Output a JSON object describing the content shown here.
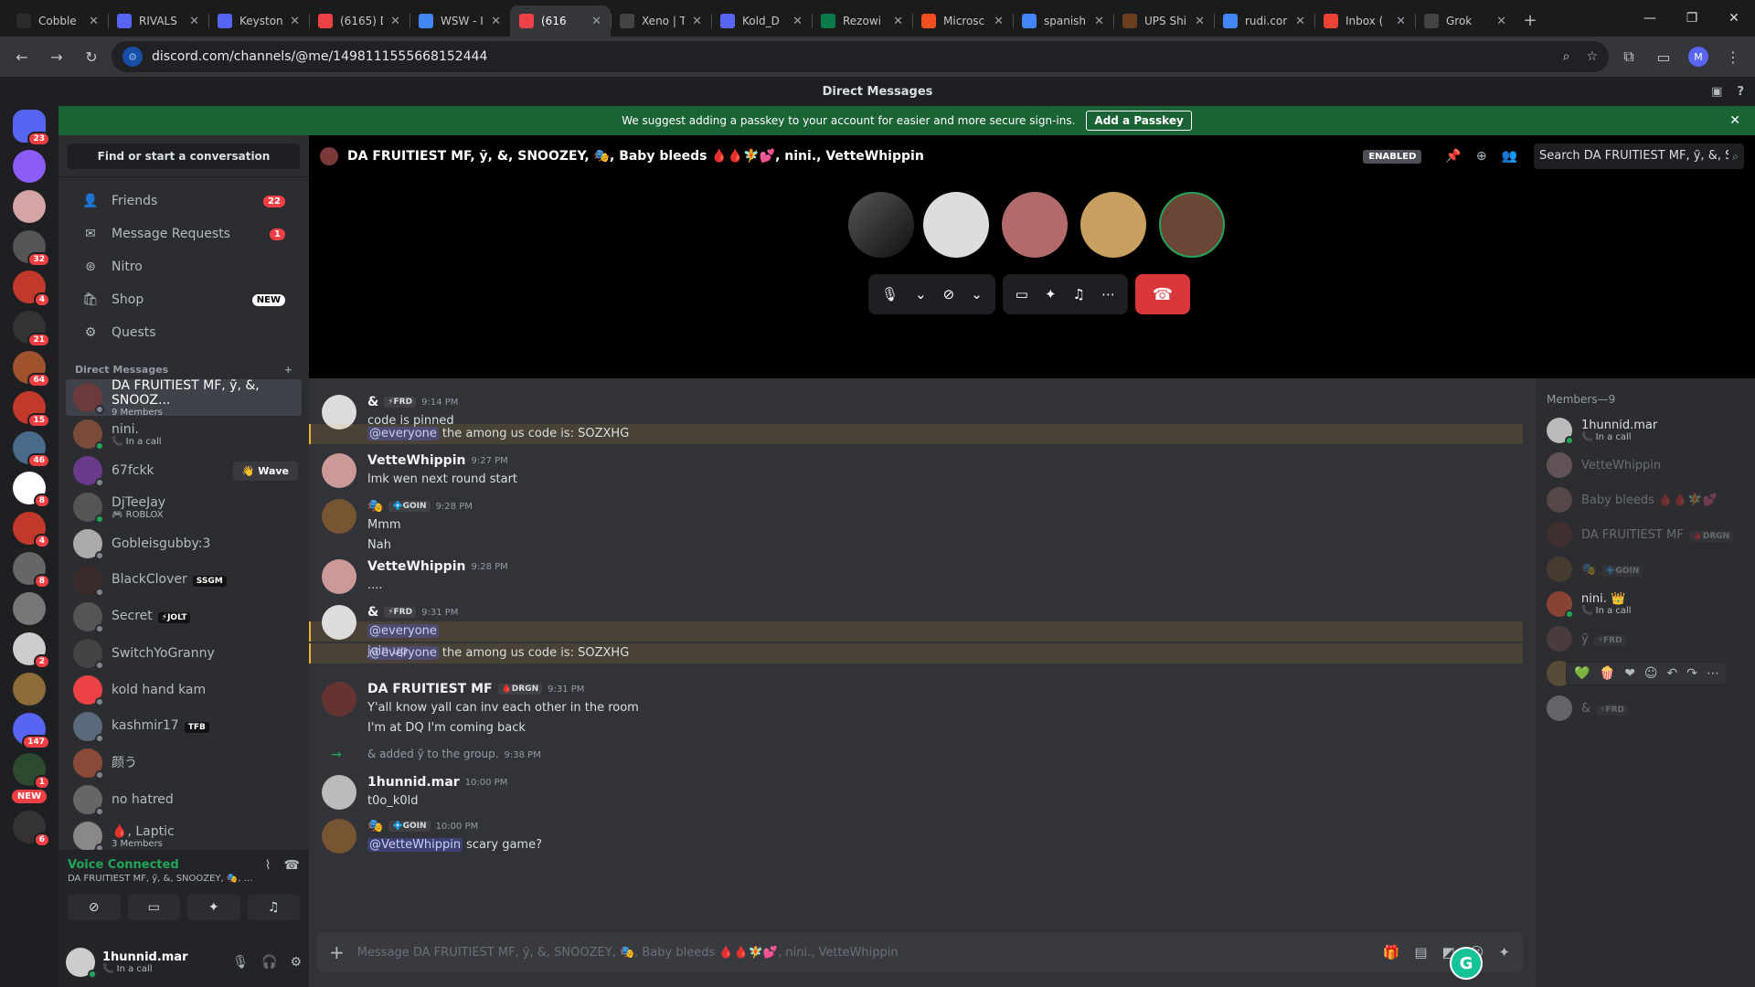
{
  "browser": {
    "tabs": [
      {
        "title": "Cobble",
        "color": "#2b2b2b"
      },
      {
        "title": "RIVALS",
        "color": "#5865f2"
      },
      {
        "title": "Keyston",
        "color": "#5865f2"
      },
      {
        "title": "(6165) D",
        "color": "#ed4245"
      },
      {
        "title": "WSW - I",
        "color": "#4285f4"
      },
      {
        "title": "(616",
        "color": "#ed4245"
      },
      {
        "title": "Xeno | T",
        "color": "#444"
      },
      {
        "title": "Kold_D",
        "color": "#5865f2"
      },
      {
        "title": "Rezowi",
        "color": "#0b7a4b"
      },
      {
        "title": "Microsc",
        "color": "#f25022"
      },
      {
        "title": "spanish",
        "color": "#4285f4"
      },
      {
        "title": "UPS Shi",
        "color": "#6b3e1f"
      },
      {
        "title": "rudi.cor",
        "color": "#4285f4"
      },
      {
        "title": "Inbox (",
        "color": "#ea4335"
      },
      {
        "title": "Grok",
        "color": "#444"
      }
    ],
    "url": "discord.com/channels/@me/1498111555668152444",
    "profile_initial": "M"
  },
  "app": {
    "window_title": "Direct Messages",
    "banner_text": "We suggest adding a passkey to your account for easier and more secure sign-ins.",
    "banner_button": "Add a Passkey"
  },
  "guilds": [
    {
      "badge": "23",
      "color": "#5865f2"
    },
    {
      "badge": "",
      "color": "#8b5cf6"
    },
    {
      "badge": "",
      "color": "#d4a5a5"
    },
    {
      "badge": "32",
      "color": "#555"
    },
    {
      "badge": "4",
      "color": "#c0392b"
    },
    {
      "badge": "21",
      "color": "#333"
    },
    {
      "badge": "64",
      "color": "#a0522d"
    },
    {
      "badge": "15",
      "color": "#c0392b"
    },
    {
      "badge": "46",
      "color": "#4a6a8a"
    },
    {
      "badge": "8",
      "color": "#fff"
    },
    {
      "badge": "4",
      "color": "#c0392b"
    },
    {
      "badge": "8",
      "color": "#666"
    },
    {
      "badge": "",
      "color": "#777"
    },
    {
      "badge": "2",
      "color": "#ccc"
    },
    {
      "badge": "",
      "color": "#8e6c3a"
    },
    {
      "badge": "147",
      "color": "#5865f2"
    },
    {
      "badge": "1",
      "color": "#2e4a2e"
    },
    {
      "badge": "6",
      "color": "#333"
    }
  ],
  "guild_new_label": "NEW",
  "dm_sidebar": {
    "search_label": "Find or start a conversation",
    "nav": [
      {
        "label": "Friends",
        "count": "22",
        "icon": "👤"
      },
      {
        "label": "Message Requests",
        "count": "1",
        "icon": "✉"
      },
      {
        "label": "Nitro",
        "count": "",
        "icon": "⊛"
      },
      {
        "label": "Shop",
        "count": "",
        "new": "NEW",
        "icon": "🛍"
      },
      {
        "label": "Quests",
        "count": "",
        "icon": "⚙"
      }
    ],
    "dm_header": "Direct Messages",
    "dm_add": "+",
    "dms": [
      {
        "name": "DA FRUITIEST MF, ỹ, &, SNOOZ...",
        "status": "9 Members",
        "color": "#6b3a3a",
        "online": false
      },
      {
        "name": "nini.",
        "status": "📞 In a call",
        "color": "#7a4a3a",
        "online": true
      },
      {
        "name": "67fckk",
        "status": "",
        "color": "#6a3a8a",
        "online": false
      },
      {
        "name": "DjTeeJay",
        "status": "🎮 ROBLOX",
        "color": "#555",
        "online": true
      },
      {
        "name": "Gobleisgubby:3",
        "status": "",
        "color": "#aaa",
        "online": false
      },
      {
        "name": "BlackClover",
        "status": "",
        "tag": "SSGM",
        "color": "#3a2a2a",
        "online": false
      },
      {
        "name": "Secret",
        "status": "",
        "tag": "⚡JOLT",
        "color": "#555",
        "online": false
      },
      {
        "name": "SwitchYoGranny",
        "status": "",
        "color": "#444",
        "online": false
      },
      {
        "name": "kold hand kam",
        "status": "",
        "color": "#ed4245",
        "online": false
      },
      {
        "name": "kashmir17",
        "status": "",
        "tag": "TFB",
        "color": "#5a6a7a",
        "online": false
      },
      {
        "name": "颜う",
        "status": "",
        "color": "#8a4a3a",
        "online": false
      },
      {
        "name": "no hatred",
        "status": "",
        "color": "#666",
        "online": false
      },
      {
        "name": "🩸, Laptic",
        "status": "3 Members",
        "color": "#888",
        "online": false
      }
    ],
    "wave_label": "👋 Wave",
    "voice": {
      "title": "Voice Connected",
      "subtitle": "DA FRUITIEST MF, ỹ, &, SNOOZEY, 🎭, ..."
    },
    "user": {
      "name": "1hunnid.mar",
      "status": "📞 In a call"
    }
  },
  "chat": {
    "header_name": "DA FRUITIEST MF, ỹ, &, SNOOZEY, 🎭, Baby bleeds 🩸🩸🧚💕, nini., VetteWhippin",
    "enabled_label": "ENABLED",
    "search_placeholder": "Search DA FRUITIEST MF, ỹ, &, S...",
    "composer_placeholder": "Message DA FRUITIEST MF, ỹ, &, SNOOZEY, 🎭, Baby bleeds 🩸🩸🧚💕, nini., VetteWhippin"
  },
  "messages": [
    {
      "author": "&",
      "tag": "⚡FRD",
      "time": "9:14 PM",
      "lines": [
        "code is pinned"
      ]
    },
    {
      "line": "the among us code is: SOZXHG",
      "mention": "@everyone"
    },
    {
      "author": "VetteWhippin",
      "time": "9:27 PM",
      "lines": [
        "lmk wen next round start"
      ]
    },
    {
      "author": "🎭",
      "tag": "💠GOIN",
      "time": "9:28 PM",
      "lines": [
        "Mmm",
        "Nah"
      ]
    },
    {
      "author": "VetteWhippin",
      "time": "9:28 PM",
      "lines": [
        "...."
      ]
    },
    {
      "author": "&",
      "tag": "⚡FRD",
      "time": "9:31 PM",
      "mention": "@everyone",
      "lines": [
        "join up"
      ]
    },
    {
      "line": "the among us code is: SOZXHG",
      "mention": "@everyone"
    },
    {
      "author": "DA FRUITIEST MF",
      "tag": "🩸DRGN",
      "time": "9:31 PM",
      "lines": [
        "Y'all know yall can inv each other in the room",
        "I'm at DQ I'm coming back"
      ]
    },
    {
      "system": "& added ỹ to the group.",
      "time": "9:38 PM"
    },
    {
      "author": "1hunnid.mar",
      "time": "10:00 PM",
      "lines": [
        "t0o_k0ld"
      ]
    },
    {
      "author": "🎭",
      "tag": "💠GOIN",
      "time": "10:00 PM",
      "mention": "@VetteWhippin",
      "text": "scary game?"
    }
  ],
  "members": {
    "header": "Members—9",
    "list": [
      {
        "name": "1hunnid.mar",
        "status": "📞 In a call",
        "off": false,
        "color": "#bbb"
      },
      {
        "name": "VetteWhippin",
        "status": "",
        "off": true,
        "color": "#c99"
      },
      {
        "name": "Baby bleeds 🩸🩸🧚💕",
        "status": "",
        "off": true,
        "color": "#a77"
      },
      {
        "name": "DA FRUITIEST MF",
        "tag": "🩸DRGN",
        "status": "",
        "off": true,
        "color": "#633"
      },
      {
        "name": "🎭",
        "tag": "💠GOIN",
        "status": "",
        "off": true,
        "color": "#753"
      },
      {
        "name": "nini. 👑",
        "status": "📞 In a call",
        "off": false,
        "color": "#843"
      },
      {
        "name": "ỹ",
        "tag": "⚡FRD",
        "status": "",
        "off": true,
        "color": "#855"
      },
      {
        "name": "SNOOZEY",
        "status": "",
        "off": true,
        "color": "#a84"
      },
      {
        "name": "&",
        "tag": "⚡FRD",
        "status": "",
        "off": true,
        "color": "#ccc"
      }
    ]
  }
}
